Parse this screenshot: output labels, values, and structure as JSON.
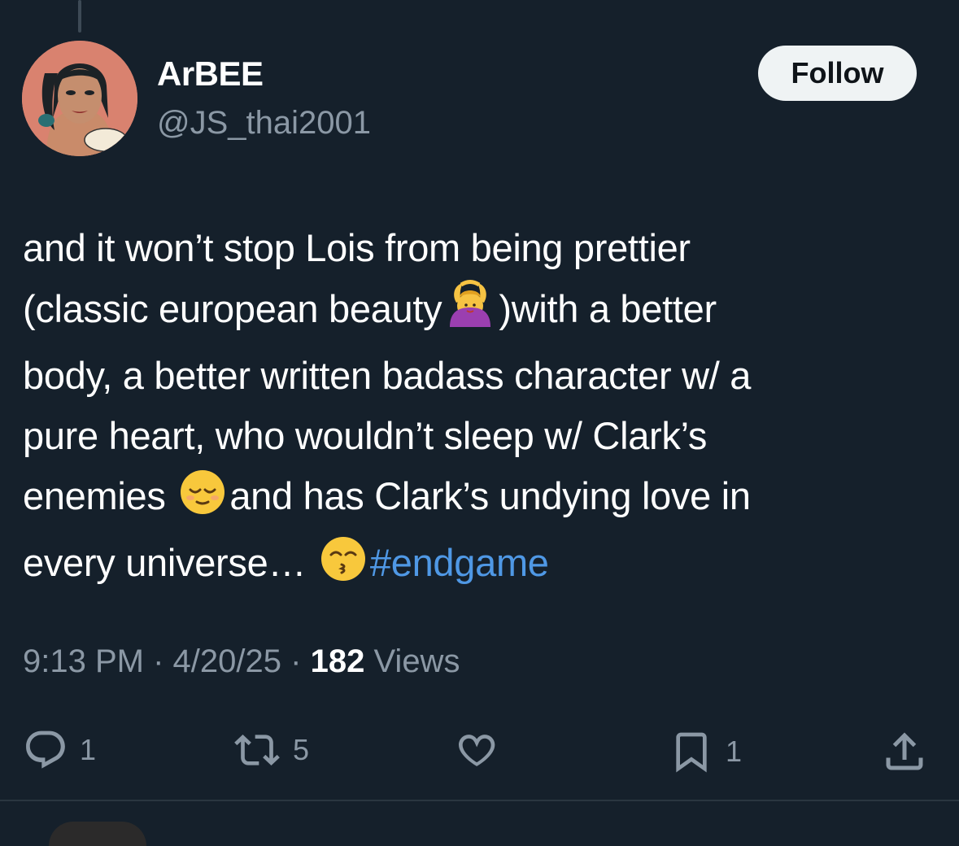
{
  "author": {
    "display_name": "ArBEE",
    "handle": "@JS_thai2001"
  },
  "follow_label": "Follow",
  "tweet": {
    "line1": "and it won’t stop Lois from being prettier",
    "line2_a": "(classic european beauty",
    "line2_b": ")with a better",
    "line3": "body, a better written badass character w/ a",
    "line4": "pure heart, who wouldn’t sleep w/ Clark’s",
    "line5_a": "enemies ",
    "line5_b": "and has Clark’s undying love in",
    "line6_a": "every universe… ",
    "hashtag": "#endgame"
  },
  "meta": {
    "time": "9:13 PM",
    "date": "4/20/25",
    "views_count": "182",
    "views_label": "Views",
    "separator": "·"
  },
  "actions": {
    "replies": "1",
    "reposts": "5",
    "bookmarks": "1"
  },
  "colors": {
    "background": "#15202b",
    "hashtag": "#4f98e5",
    "secondary_text": "#8b98a5"
  },
  "icons": [
    "reply-icon",
    "repost-icon",
    "like-icon",
    "bookmark-icon",
    "share-icon"
  ]
}
